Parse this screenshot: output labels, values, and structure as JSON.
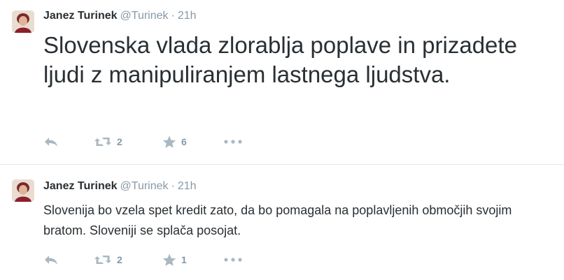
{
  "tweets": [
    {
      "name": "Janez Turinek",
      "handle": "@Turinek",
      "separator": "·",
      "time": "21h",
      "text": "Slovenska vlada zlorablja poplave in prizadete ljudi z manipuliranjem lastnega ljudstva.",
      "retweets": "2",
      "favorites": "6"
    },
    {
      "name": "Janez Turinek",
      "handle": "@Turinek",
      "separator": "·",
      "time": "21h",
      "text": "Slovenija bo vzela spet kredit zato, da bo pomagala na poplavljenih območjih svojim bratom. Sloveniji se splača posojat.",
      "retweets": "2",
      "favorites": "1"
    }
  ],
  "icons": {
    "reply": "reply-icon",
    "retweet": "retweet-icon",
    "favorite": "star-icon",
    "more": "more-icon"
  },
  "colors": {
    "text": "#292f33",
    "muted": "#8899a6",
    "icon": "#aab8c2",
    "divider": "#e1e8ed"
  }
}
